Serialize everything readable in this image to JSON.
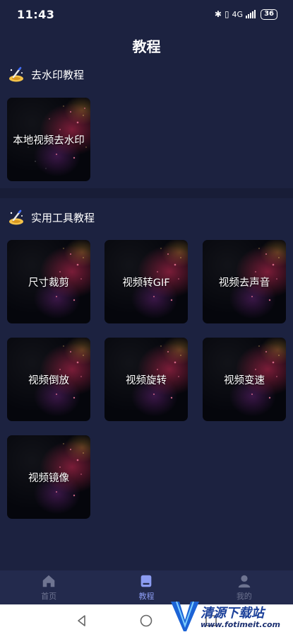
{
  "status_bar": {
    "time": "11:43",
    "network": "4G",
    "battery": "36"
  },
  "page": {
    "title": "教程"
  },
  "sections": [
    {
      "title": "去水印教程",
      "icon": "magic-wand-icon"
    },
    {
      "title": "实用工具教程",
      "icon": "magic-wand-icon"
    }
  ],
  "watermark_cards": [
    {
      "label": "本地视频去水印"
    }
  ],
  "tool_cards": [
    {
      "label": "尺寸裁剪"
    },
    {
      "label": "视频转GIF"
    },
    {
      "label": "视频去声音"
    },
    {
      "label": "视频倒放"
    },
    {
      "label": "视频旋转"
    },
    {
      "label": "视频变速"
    },
    {
      "label": "视频镜像"
    }
  ],
  "bottom_nav": {
    "items": [
      {
        "label": "首页",
        "icon": "home-icon",
        "active": false
      },
      {
        "label": "教程",
        "icon": "book-icon",
        "active": true
      },
      {
        "label": "我的",
        "icon": "user-icon",
        "active": false
      }
    ]
  },
  "watermark_overlay": {
    "title": "清源下载站",
    "url": "www.fotimeit.com"
  },
  "colors": {
    "background": "#1c2240",
    "nav_background": "#232a4d",
    "active_nav": "#8c9cf2",
    "inactive_nav": "#6e7491"
  }
}
